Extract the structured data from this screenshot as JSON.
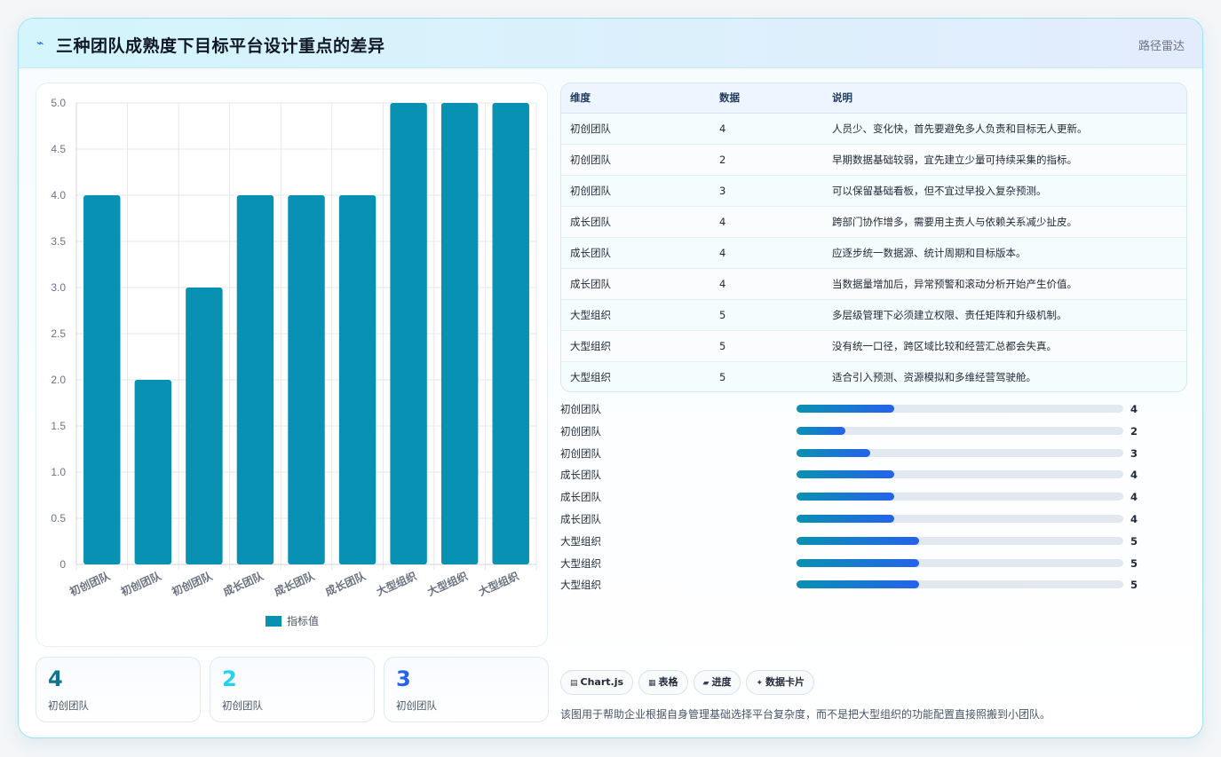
{
  "header": {
    "icon": "wave-icon",
    "title": "三种团队成熟度下目标平台设计重点的差异",
    "tag": "路径雷达"
  },
  "chart_data": {
    "type": "bar",
    "categories": [
      "初创团队",
      "初创团队",
      "初创团队",
      "成长团队",
      "成长团队",
      "成长团队",
      "大型组织",
      "大型组织",
      "大型组织"
    ],
    "series": [
      {
        "name": "指标值",
        "values": [
          4,
          2,
          3,
          4,
          4,
          4,
          5,
          5,
          5
        ],
        "color": "#0891b2"
      }
    ],
    "ylim": [
      0,
      5
    ],
    "yticks": [
      "0",
      "0.5",
      "1.0",
      "1.5",
      "2.0",
      "2.5",
      "3.0",
      "3.5",
      "4.0",
      "4.5",
      "5.0"
    ],
    "legend_position": "bottom",
    "grid": true
  },
  "stats": [
    {
      "value": "4",
      "label": "初创团队",
      "color": "#0e7490"
    },
    {
      "value": "2",
      "label": "初创团队",
      "color": "#22d3ee"
    },
    {
      "value": "3",
      "label": "初创团队",
      "color": "#2563eb"
    }
  ],
  "table": {
    "headers": [
      "维度",
      "数据",
      "说明"
    ],
    "rows": [
      [
        "初创团队",
        "4",
        "人员少、变化快，首先要避免多人负责和目标无人更新。"
      ],
      [
        "初创团队",
        "2",
        "早期数据基础较弱，宜先建立少量可持续采集的指标。"
      ],
      [
        "初创团队",
        "3",
        "可以保留基础看板，但不宜过早投入复杂预测。"
      ],
      [
        "成长团队",
        "4",
        "跨部门协作增多，需要用主责人与依赖关系减少扯皮。"
      ],
      [
        "成长团队",
        "4",
        "应逐步统一数据源、统计周期和目标版本。"
      ],
      [
        "成长团队",
        "4",
        "当数据量增加后，异常预警和滚动分析开始产生价值。"
      ],
      [
        "大型组织",
        "5",
        "多层级管理下必须建立权限、责任矩阵和升级机制。"
      ],
      [
        "大型组织",
        "5",
        "没有统一口径，跨区域比较和经营汇总都会失真。"
      ],
      [
        "大型组织",
        "5",
        "适合引入预测、资源模拟和多维经营驾驶舱。"
      ]
    ]
  },
  "progress": {
    "max": 5,
    "fill_fraction_of_max": 0.375,
    "items": [
      {
        "label": "初创团队",
        "value": 4
      },
      {
        "label": "初创团队",
        "value": 2
      },
      {
        "label": "初创团队",
        "value": 3
      },
      {
        "label": "成长团队",
        "value": 4
      },
      {
        "label": "成长团队",
        "value": 4
      },
      {
        "label": "成长团队",
        "value": 4
      },
      {
        "label": "大型组织",
        "value": 5
      },
      {
        "label": "大型组织",
        "value": 5
      },
      {
        "label": "大型组织",
        "value": 5
      }
    ]
  },
  "chips": [
    {
      "icon": "▤",
      "label": "Chart.js"
    },
    {
      "icon": "▦",
      "label": "表格"
    },
    {
      "icon": "▰",
      "label": "进度"
    },
    {
      "icon": "✦",
      "label": "数据卡片"
    }
  ],
  "footer": "该图用于帮助企业根据自身管理基础选择平台复杂度，而不是把大型组织的功能配置直接照搬到小团队。"
}
